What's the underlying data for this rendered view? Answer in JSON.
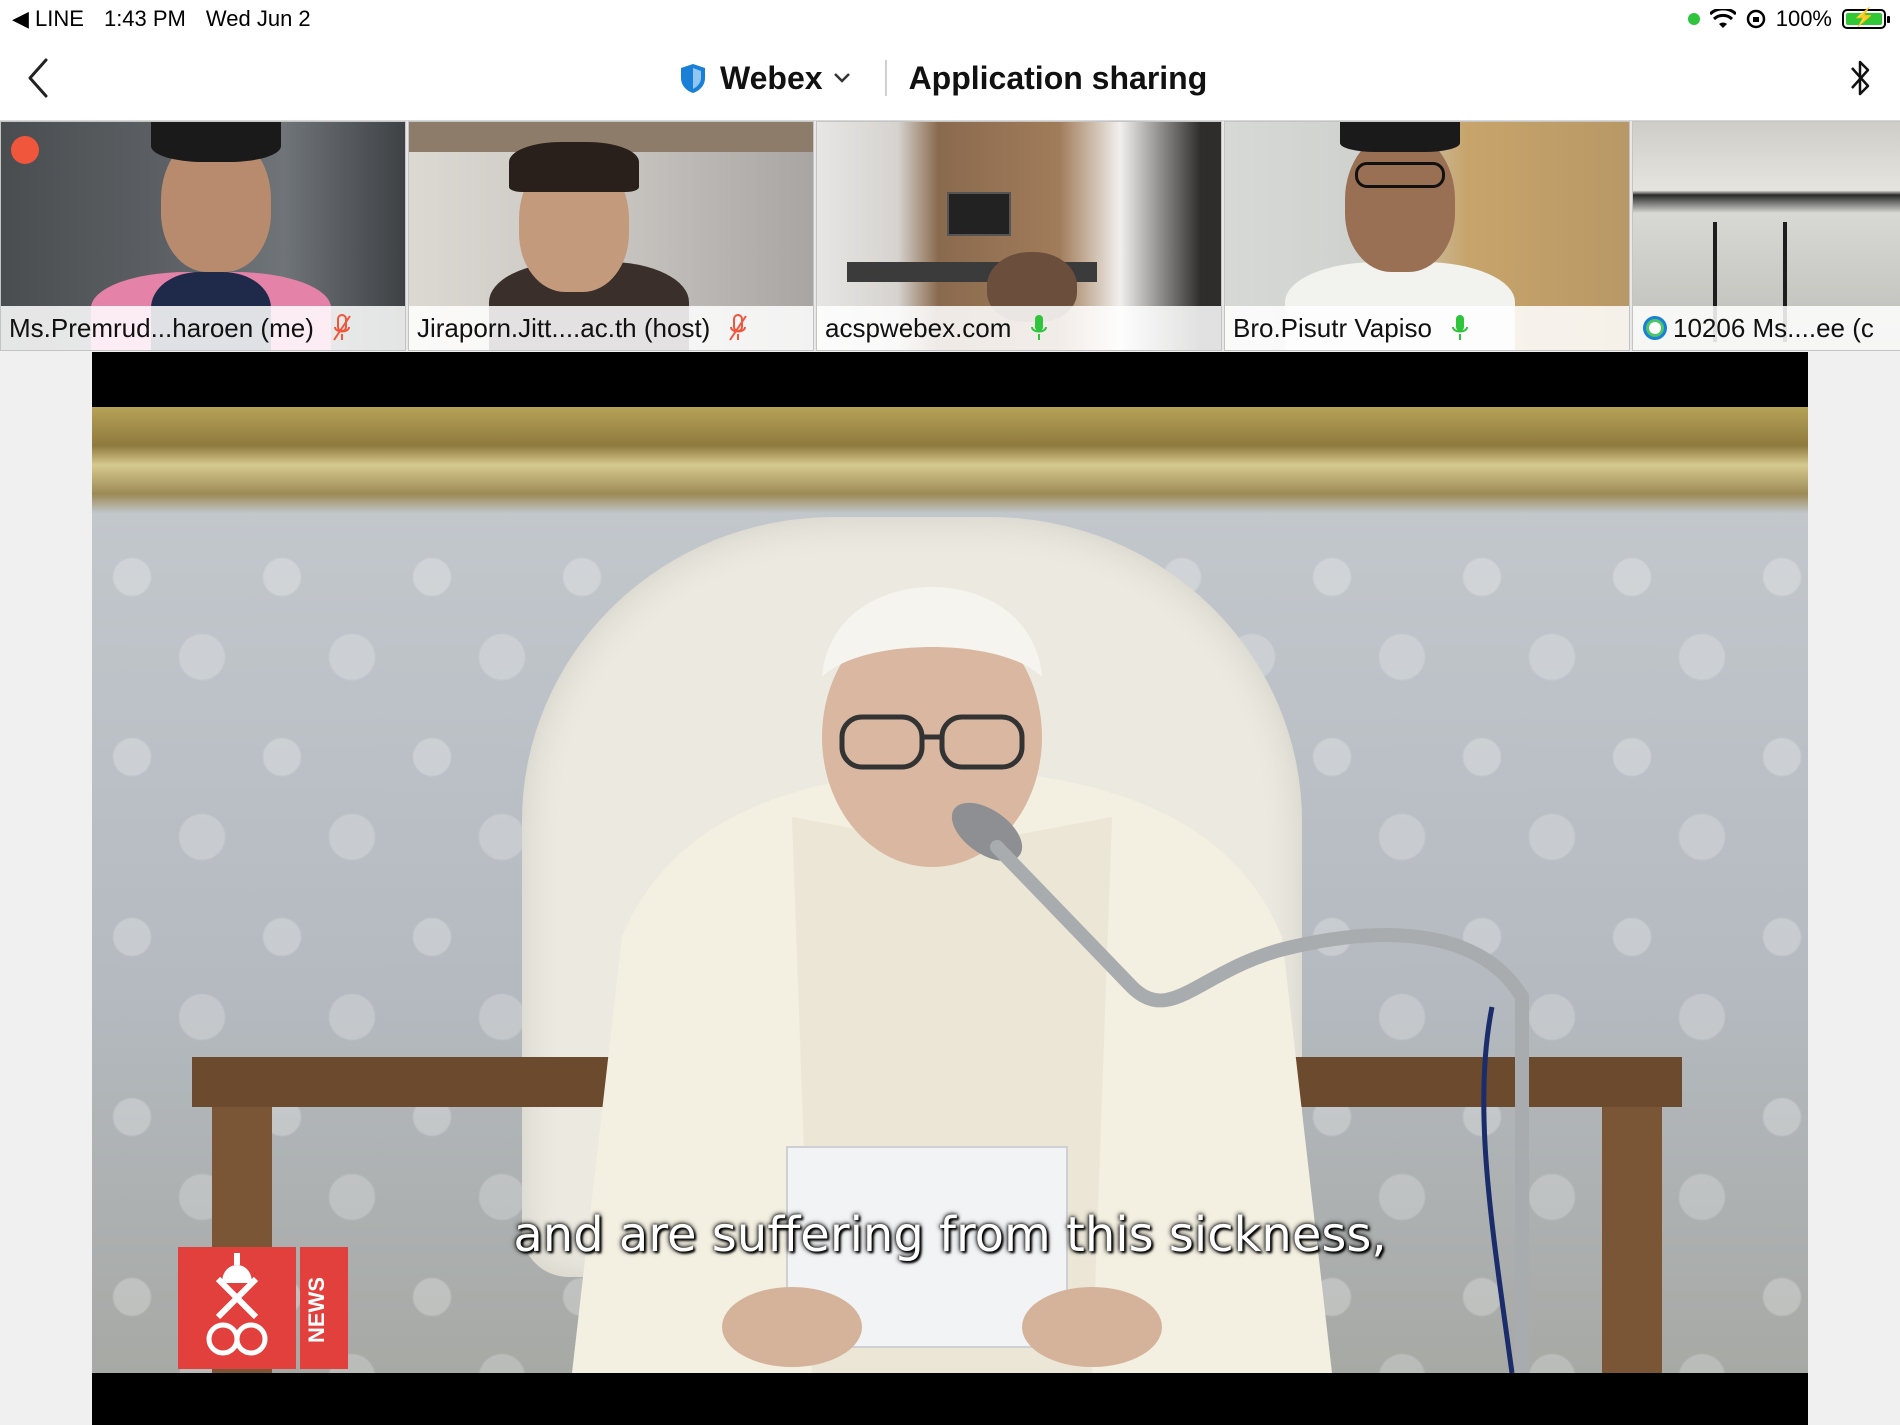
{
  "status_bar": {
    "back_app": "◀ LINE",
    "time": "1:43 PM",
    "date": "Wed Jun 2",
    "battery_percent": "100%",
    "battery_level": 1.0
  },
  "header": {
    "app_name": "Webex",
    "title": "Application sharing"
  },
  "participants": [
    {
      "name": "Ms.Premrud...haroen (me)",
      "mic": "muted"
    },
    {
      "name": "Jiraporn.Jitt....ac.th (host)",
      "mic": "muted"
    },
    {
      "name": "acspwebex.com",
      "mic": "on"
    },
    {
      "name": "Bro.Pisutr Vapiso",
      "mic": "on"
    },
    {
      "name": "10206 Ms....ee (c",
      "mic": "none"
    }
  ],
  "shared_content": {
    "subtitle": "and are suffering from this sickness,",
    "logo_text": "NEWS"
  },
  "colors": {
    "accent_blue": "#1a7fd6",
    "mic_muted": "#f0563c",
    "mic_on": "#2ec43c"
  }
}
